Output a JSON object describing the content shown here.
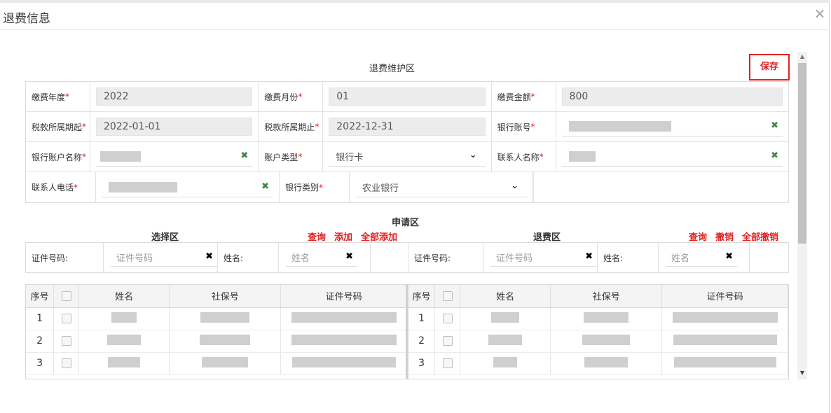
{
  "dialog": {
    "title": "退费信息",
    "close_glyph": "×"
  },
  "maintenance": {
    "title": "退费维护区",
    "save_label": "保存",
    "fields": {
      "pay_year": {
        "label": "缴费年度",
        "value": "2022"
      },
      "pay_month": {
        "label": "缴费月份",
        "value": "01"
      },
      "pay_amount": {
        "label": "缴费金额",
        "value": "800"
      },
      "tax_start": {
        "label": "税款所属期起",
        "value": "2022-01-01"
      },
      "tax_end": {
        "label": "税款所属期止",
        "value": "2022-12-31"
      },
      "bank_account": {
        "label": "银行账号",
        "value": ""
      },
      "bank_account_name": {
        "label": "银行账户名称",
        "value": ""
      },
      "account_type": {
        "label": "账户类型",
        "value": "银行卡"
      },
      "contact_name": {
        "label": "联系人名称",
        "value": ""
      },
      "contact_phone": {
        "label": "联系人电话",
        "value": ""
      },
      "bank_category": {
        "label": "银行类别",
        "value": "农业银行"
      }
    },
    "required_mark": "*"
  },
  "apply": {
    "title": "申请区",
    "select_area": {
      "title": "选择区",
      "actions": {
        "query": "查询",
        "add": "添加",
        "add_all": "全部添加"
      },
      "filters": {
        "id_label": "证件号码:",
        "id_placeholder": "证件号码",
        "name_label": "姓名:",
        "name_placeholder": "姓名"
      },
      "columns": [
        "序号",
        "",
        "姓名",
        "社保号",
        "证件号码"
      ],
      "rows": [
        {
          "seq": "1"
        },
        {
          "seq": "2"
        },
        {
          "seq": "3"
        }
      ]
    },
    "refund_area": {
      "title": "退费区",
      "actions": {
        "query": "查询",
        "revoke": "撤销",
        "revoke_all": "全部撤销"
      },
      "filters": {
        "id_label": "证件号码:",
        "id_placeholder": "证件号码",
        "name_label": "姓名:",
        "name_placeholder": "姓名"
      },
      "columns": [
        "序号",
        "",
        "姓名",
        "社保号",
        "证件号码"
      ],
      "rows": [
        {
          "seq": "1"
        },
        {
          "seq": "2"
        },
        {
          "seq": "3"
        }
      ]
    }
  },
  "icons": {
    "clear_green": "✖",
    "clear_black": "✖",
    "dropdown": "chevron-down-icon"
  },
  "colors": {
    "accent_red": "#e02020",
    "clear_green": "#3d8a3d"
  }
}
